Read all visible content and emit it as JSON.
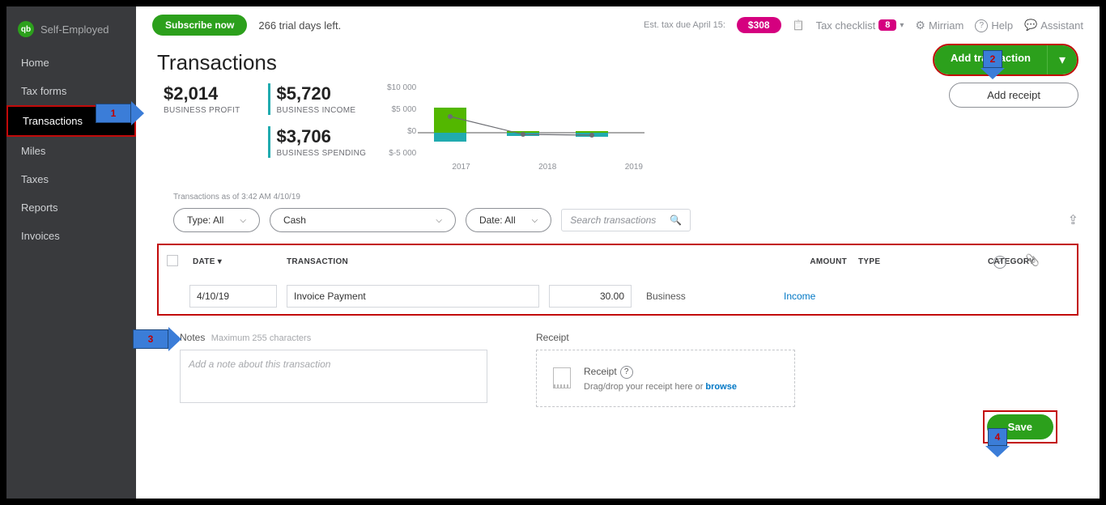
{
  "app": {
    "name": "Self-Employed"
  },
  "topbar": {
    "subscribe": "Subscribe now",
    "trial": "266 trial days left.",
    "tax_due_label": "Est. tax due April 15:",
    "tax_due_amount": "$308",
    "checklist_label": "Tax checklist",
    "checklist_count": "8",
    "user": "Mirriam",
    "help": "Help",
    "assistant": "Assistant"
  },
  "sidebar": {
    "items": [
      "Home",
      "Tax forms",
      "Transactions",
      "Miles",
      "Taxes",
      "Reports",
      "Invoices"
    ],
    "active_index": 2
  },
  "page": {
    "title": "Transactions",
    "add_transaction": "Add transaction",
    "add_receipt": "Add receipt"
  },
  "stats": {
    "profit_value": "$2,014",
    "profit_label": "BUSINESS PROFIT",
    "income_value": "$5,720",
    "income_label": "BUSINESS INCOME",
    "spending_value": "$3,706",
    "spending_label": "BUSINESS SPENDING"
  },
  "chart_data": {
    "type": "bar",
    "categories": [
      "2017",
      "2018",
      "2019"
    ],
    "series": [
      {
        "name": "Income",
        "values": [
          5000,
          350,
          350
        ],
        "color": "#53b700"
      },
      {
        "name": "Spending",
        "values": [
          -1800,
          -600,
          -800
        ],
        "color": "#21abaf"
      },
      {
        "name": "Profit",
        "values": [
          3200,
          -250,
          -450
        ],
        "color": "#6b6c72"
      }
    ],
    "y_ticks": [
      "$10 000",
      "$5 000",
      "$0",
      "$-5 000"
    ],
    "ylim": [
      -5000,
      10000
    ]
  },
  "timestamp": "Transactions as of 3:42 AM 4/10/19",
  "filters": {
    "type": "Type: All",
    "account": "Cash",
    "date": "Date: All",
    "search_placeholder": "Search transactions"
  },
  "table": {
    "headers": {
      "date": "DATE ▾",
      "transaction": "TRANSACTION",
      "amount": "AMOUNT",
      "type": "TYPE",
      "category": "CATEGORY"
    },
    "row": {
      "date": "4/10/19",
      "transaction": "Invoice Payment",
      "amount": "30.00",
      "type": "Business",
      "category": "Income"
    }
  },
  "notes": {
    "label": "Notes",
    "hint": "Maximum 255 characters",
    "placeholder": "Add a note about this transaction"
  },
  "receipt": {
    "label": "Receipt",
    "title": "Receipt",
    "text": "Drag/drop your receipt here or ",
    "browse": "browse"
  },
  "save": "Save",
  "annotations": {
    "a1": "1",
    "a2": "2",
    "a3": "3",
    "a4": "4"
  }
}
